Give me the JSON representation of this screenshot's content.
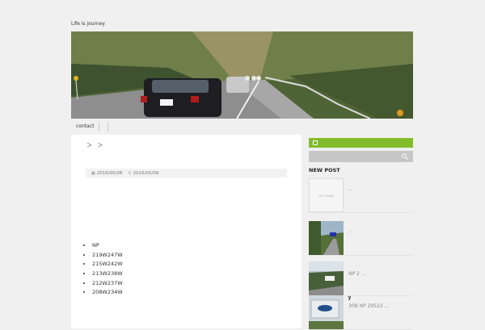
{
  "site": {
    "title": "Life is journey"
  },
  "nav": {
    "items": [
      {
        "label": "contact"
      }
    ]
  },
  "breadcrumb": {
    "text": "＞ ＞"
  },
  "article": {
    "published": "2016/05/08",
    "updated": "2016/05/09",
    "list": [
      "NP",
      "219W247W",
      "215W242W",
      "213W238W",
      "212W237W",
      "208W234W"
    ]
  },
  "sidebar": {
    "widget_title": "NEW POST",
    "posts": [
      {
        "title": "",
        "excerpt": "...",
        "thumb": "no image"
      },
      {
        "title": "",
        "excerpt": "...",
        "thumb": ""
      },
      {
        "title": "",
        "excerpt": "NP 2 ...",
        "thumb": ""
      },
      {
        "title": "7",
        "excerpt": "30B NP 29522 ...",
        "thumb": ""
      }
    ]
  },
  "colors": {
    "rss": "#82bc2a",
    "search": "#c6c6c6",
    "background": "#f0f0f0"
  },
  "icons": {
    "published": "calendar-icon",
    "updated": "refresh-icon",
    "rss": "rss-icon",
    "search": "search-icon"
  }
}
